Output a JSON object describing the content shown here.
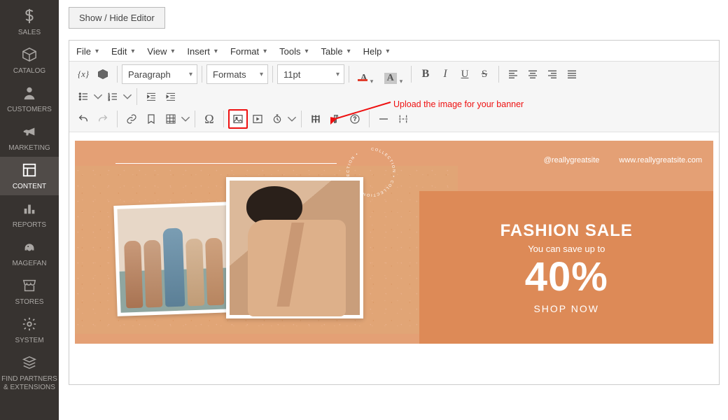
{
  "sidebar": {
    "items": [
      {
        "label": "SALES",
        "name": "sidebar-item-sales"
      },
      {
        "label": "CATALOG",
        "name": "sidebar-item-catalog"
      },
      {
        "label": "CUSTOMERS",
        "name": "sidebar-item-customers"
      },
      {
        "label": "MARKETING",
        "name": "sidebar-item-marketing"
      },
      {
        "label": "CONTENT",
        "name": "sidebar-item-content",
        "active": true
      },
      {
        "label": "REPORTS",
        "name": "sidebar-item-reports"
      },
      {
        "label": "MAGEFAN",
        "name": "sidebar-item-magefan"
      },
      {
        "label": "STORES",
        "name": "sidebar-item-stores"
      },
      {
        "label": "SYSTEM",
        "name": "sidebar-item-system"
      },
      {
        "label": "FIND PARTNERS & EXTENSIONS",
        "name": "sidebar-item-find-partners"
      }
    ]
  },
  "toggle_button": "Show / Hide Editor",
  "menubar": {
    "items": [
      "File",
      "Edit",
      "View",
      "Insert",
      "Format",
      "Tools",
      "Table",
      "Help"
    ]
  },
  "toolbar": {
    "block_format": "Paragraph",
    "style_format": "Formats",
    "font_size": "11pt",
    "font_color_letter": "A",
    "bg_color_letter": "A",
    "omega": "Ω",
    "variable": "{x}"
  },
  "annotation": "Upload the image for your banner",
  "banner": {
    "circ_text": "COLLECTION • COLLECTION • COLLECTION •",
    "social": "@reallygreatsite",
    "website": "www.reallygreatsite.com",
    "title": "FASHION SALE",
    "sub": "You can save up to",
    "percent": "40%",
    "cta": "SHOP NOW"
  },
  "colors": {
    "highlight": "#e11",
    "accent": "#dd8a57"
  }
}
